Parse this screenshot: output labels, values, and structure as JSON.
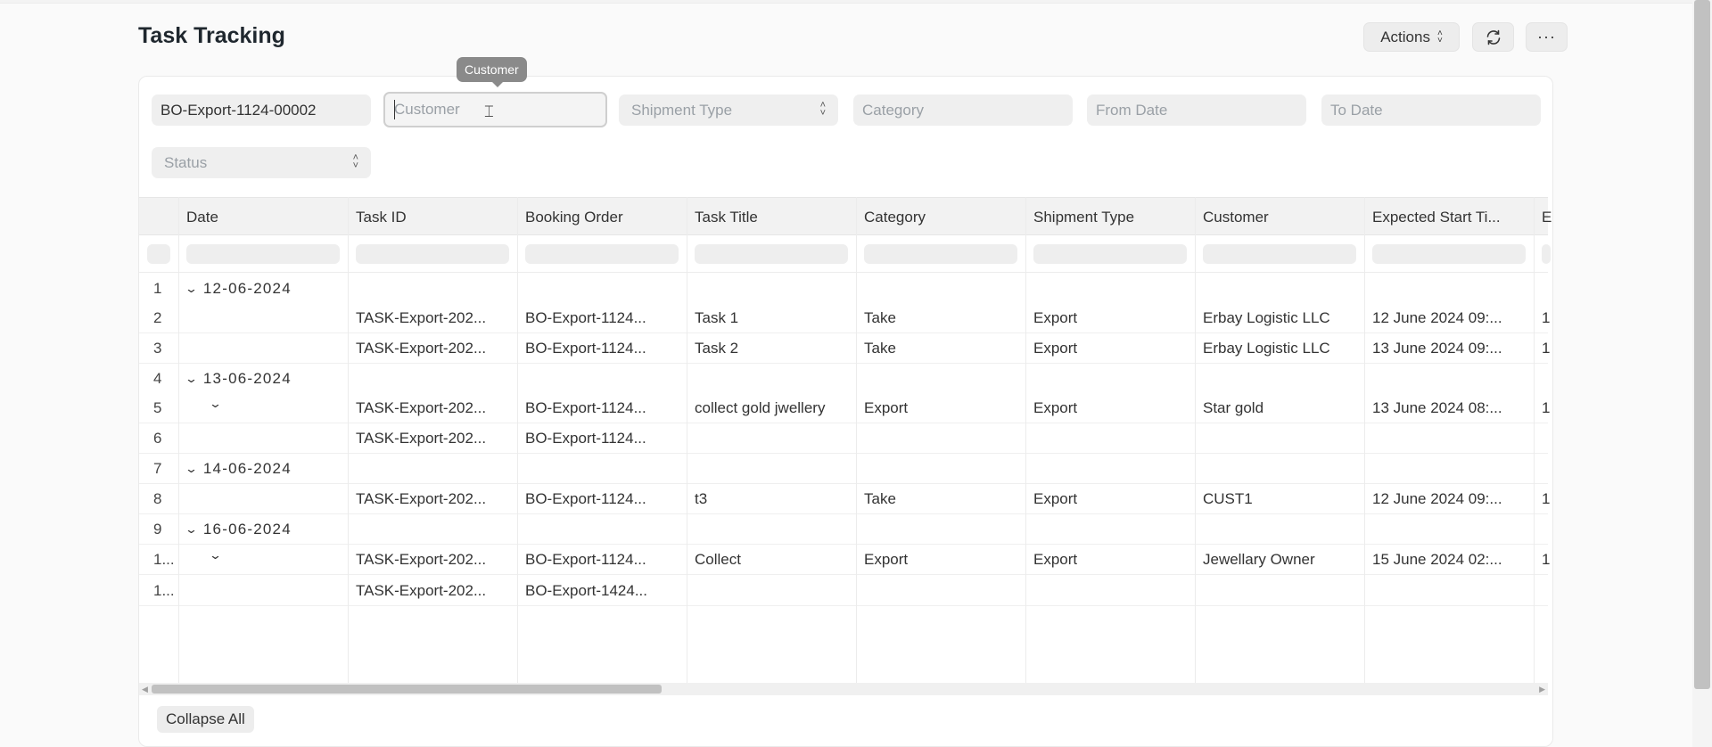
{
  "page": {
    "title": "Task Tracking",
    "actions_label": "Actions",
    "refresh_icon": "refresh-icon",
    "more_label": "···"
  },
  "filters": {
    "booking_order": "BO-Export-1124-00002",
    "customer_placeholder": "Customer",
    "shipment_type_placeholder": "Shipment Type",
    "category_placeholder": "Category",
    "from_date_placeholder": "From Date",
    "to_date_placeholder": "To Date",
    "status_placeholder": "Status",
    "tooltip": "Customer"
  },
  "table": {
    "columns": [
      "Date",
      "Task ID",
      "Booking Order",
      "Task Title",
      "Category",
      "Shipment Type",
      "Customer",
      "Expected Start Ti...",
      "E"
    ],
    "rows": [
      {
        "num": "1",
        "date": "12-06-2024",
        "group": true,
        "sub": false,
        "task_id": "",
        "booking": "",
        "title": "",
        "category": "",
        "shipment": "",
        "customer": "",
        "start": "",
        "extra": ""
      },
      {
        "num": "2",
        "date": "",
        "group": false,
        "sub": false,
        "task_id": "TASK-Export-202...",
        "booking": "BO-Export-1124...",
        "title": "Task 1",
        "category": "Take",
        "shipment": "Export",
        "customer": "Erbay Logistic LLC",
        "start": "12 June 2024 09:...",
        "extra": "1"
      },
      {
        "num": "3",
        "date": "",
        "group": false,
        "sub": false,
        "task_id": "TASK-Export-202...",
        "booking": "BO-Export-1124...",
        "title": "Task 2",
        "category": "Take",
        "shipment": "Export",
        "customer": "Erbay Logistic LLC",
        "start": "13 June 2024 09:...",
        "extra": "1"
      },
      {
        "num": "4",
        "date": "13-06-2024",
        "group": true,
        "sub": false,
        "task_id": "",
        "booking": "",
        "title": "",
        "category": "",
        "shipment": "",
        "customer": "",
        "start": "",
        "extra": ""
      },
      {
        "num": "5",
        "date": "",
        "group": false,
        "sub": true,
        "task_id": "TASK-Export-202...",
        "booking": "BO-Export-1124...",
        "title": "collect gold jwellery",
        "category": "Export",
        "shipment": "Export",
        "customer": "Star gold",
        "start": "13 June 2024 08:...",
        "extra": "1"
      },
      {
        "num": "6",
        "date": "",
        "group": false,
        "sub": false,
        "task_id": "TASK-Export-202...",
        "booking": "BO-Export-1124...",
        "title": "",
        "category": "",
        "shipment": "",
        "customer": "",
        "start": "",
        "extra": ""
      },
      {
        "num": "7",
        "date": "14-06-2024",
        "group": true,
        "sub": false,
        "task_id": "",
        "booking": "",
        "title": "",
        "category": "",
        "shipment": "",
        "customer": "",
        "start": "",
        "extra": ""
      },
      {
        "num": "8",
        "date": "",
        "group": false,
        "sub": false,
        "task_id": "TASK-Export-202...",
        "booking": "BO-Export-1124...",
        "title": "t3",
        "category": "Take",
        "shipment": "Export",
        "customer": "CUST1",
        "start": "12 June 2024 09:...",
        "extra": "1"
      },
      {
        "num": "9",
        "date": "16-06-2024",
        "group": true,
        "sub": false,
        "task_id": "",
        "booking": "",
        "title": "",
        "category": "",
        "shipment": "",
        "customer": "",
        "start": "",
        "extra": ""
      },
      {
        "num": "1...",
        "date": "",
        "group": false,
        "sub": true,
        "task_id": "TASK-Export-202...",
        "booking": "BO-Export-1124...",
        "title": "Collect",
        "category": "Export",
        "shipment": "Export",
        "customer": "Jewellary Owner",
        "start": "15 June 2024 02:...",
        "extra": "1"
      },
      {
        "num": "1...",
        "date": "",
        "group": false,
        "sub": false,
        "task_id": "TASK-Export-202...",
        "booking": "BO-Export-1424...",
        "title": "",
        "category": "",
        "shipment": "",
        "customer": "",
        "start": "",
        "extra": ""
      }
    ]
  },
  "footer": {
    "collapse_all_label": "Collapse All"
  }
}
